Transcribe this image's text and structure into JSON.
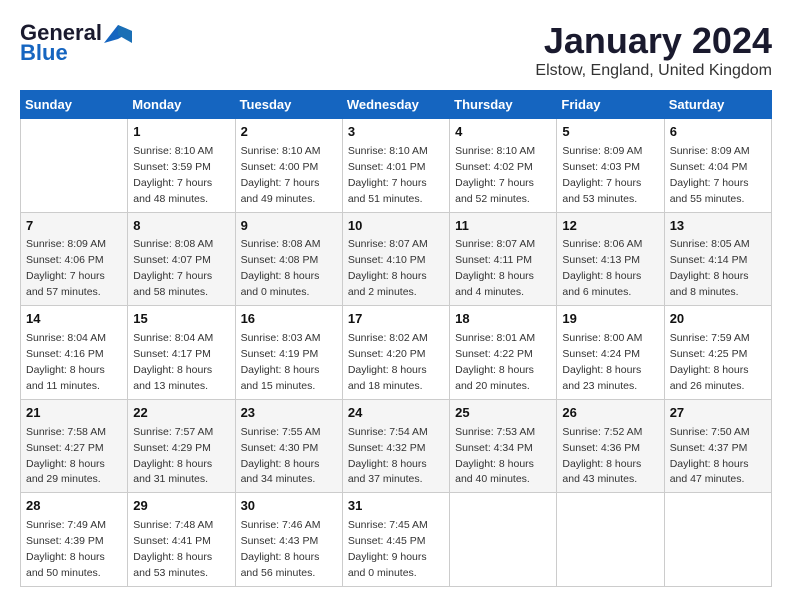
{
  "logo": {
    "line1": "General",
    "line2": "Blue"
  },
  "header": {
    "month": "January 2024",
    "location": "Elstow, England, United Kingdom"
  },
  "weekdays": [
    "Sunday",
    "Monday",
    "Tuesday",
    "Wednesday",
    "Thursday",
    "Friday",
    "Saturday"
  ],
  "weeks": [
    [
      {
        "day": "",
        "detail": ""
      },
      {
        "day": "1",
        "detail": "Sunrise: 8:10 AM\nSunset: 3:59 PM\nDaylight: 7 hours\nand 48 minutes."
      },
      {
        "day": "2",
        "detail": "Sunrise: 8:10 AM\nSunset: 4:00 PM\nDaylight: 7 hours\nand 49 minutes."
      },
      {
        "day": "3",
        "detail": "Sunrise: 8:10 AM\nSunset: 4:01 PM\nDaylight: 7 hours\nand 51 minutes."
      },
      {
        "day": "4",
        "detail": "Sunrise: 8:10 AM\nSunset: 4:02 PM\nDaylight: 7 hours\nand 52 minutes."
      },
      {
        "day": "5",
        "detail": "Sunrise: 8:09 AM\nSunset: 4:03 PM\nDaylight: 7 hours\nand 53 minutes."
      },
      {
        "day": "6",
        "detail": "Sunrise: 8:09 AM\nSunset: 4:04 PM\nDaylight: 7 hours\nand 55 minutes."
      }
    ],
    [
      {
        "day": "7",
        "detail": "Sunrise: 8:09 AM\nSunset: 4:06 PM\nDaylight: 7 hours\nand 57 minutes."
      },
      {
        "day": "8",
        "detail": "Sunrise: 8:08 AM\nSunset: 4:07 PM\nDaylight: 7 hours\nand 58 minutes."
      },
      {
        "day": "9",
        "detail": "Sunrise: 8:08 AM\nSunset: 4:08 PM\nDaylight: 8 hours\nand 0 minutes."
      },
      {
        "day": "10",
        "detail": "Sunrise: 8:07 AM\nSunset: 4:10 PM\nDaylight: 8 hours\nand 2 minutes."
      },
      {
        "day": "11",
        "detail": "Sunrise: 8:07 AM\nSunset: 4:11 PM\nDaylight: 8 hours\nand 4 minutes."
      },
      {
        "day": "12",
        "detail": "Sunrise: 8:06 AM\nSunset: 4:13 PM\nDaylight: 8 hours\nand 6 minutes."
      },
      {
        "day": "13",
        "detail": "Sunrise: 8:05 AM\nSunset: 4:14 PM\nDaylight: 8 hours\nand 8 minutes."
      }
    ],
    [
      {
        "day": "14",
        "detail": "Sunrise: 8:04 AM\nSunset: 4:16 PM\nDaylight: 8 hours\nand 11 minutes."
      },
      {
        "day": "15",
        "detail": "Sunrise: 8:04 AM\nSunset: 4:17 PM\nDaylight: 8 hours\nand 13 minutes."
      },
      {
        "day": "16",
        "detail": "Sunrise: 8:03 AM\nSunset: 4:19 PM\nDaylight: 8 hours\nand 15 minutes."
      },
      {
        "day": "17",
        "detail": "Sunrise: 8:02 AM\nSunset: 4:20 PM\nDaylight: 8 hours\nand 18 minutes."
      },
      {
        "day": "18",
        "detail": "Sunrise: 8:01 AM\nSunset: 4:22 PM\nDaylight: 8 hours\nand 20 minutes."
      },
      {
        "day": "19",
        "detail": "Sunrise: 8:00 AM\nSunset: 4:24 PM\nDaylight: 8 hours\nand 23 minutes."
      },
      {
        "day": "20",
        "detail": "Sunrise: 7:59 AM\nSunset: 4:25 PM\nDaylight: 8 hours\nand 26 minutes."
      }
    ],
    [
      {
        "day": "21",
        "detail": "Sunrise: 7:58 AM\nSunset: 4:27 PM\nDaylight: 8 hours\nand 29 minutes."
      },
      {
        "day": "22",
        "detail": "Sunrise: 7:57 AM\nSunset: 4:29 PM\nDaylight: 8 hours\nand 31 minutes."
      },
      {
        "day": "23",
        "detail": "Sunrise: 7:55 AM\nSunset: 4:30 PM\nDaylight: 8 hours\nand 34 minutes."
      },
      {
        "day": "24",
        "detail": "Sunrise: 7:54 AM\nSunset: 4:32 PM\nDaylight: 8 hours\nand 37 minutes."
      },
      {
        "day": "25",
        "detail": "Sunrise: 7:53 AM\nSunset: 4:34 PM\nDaylight: 8 hours\nand 40 minutes."
      },
      {
        "day": "26",
        "detail": "Sunrise: 7:52 AM\nSunset: 4:36 PM\nDaylight: 8 hours\nand 43 minutes."
      },
      {
        "day": "27",
        "detail": "Sunrise: 7:50 AM\nSunset: 4:37 PM\nDaylight: 8 hours\nand 47 minutes."
      }
    ],
    [
      {
        "day": "28",
        "detail": "Sunrise: 7:49 AM\nSunset: 4:39 PM\nDaylight: 8 hours\nand 50 minutes."
      },
      {
        "day": "29",
        "detail": "Sunrise: 7:48 AM\nSunset: 4:41 PM\nDaylight: 8 hours\nand 53 minutes."
      },
      {
        "day": "30",
        "detail": "Sunrise: 7:46 AM\nSunset: 4:43 PM\nDaylight: 8 hours\nand 56 minutes."
      },
      {
        "day": "31",
        "detail": "Sunrise: 7:45 AM\nSunset: 4:45 PM\nDaylight: 9 hours\nand 0 minutes."
      },
      {
        "day": "",
        "detail": ""
      },
      {
        "day": "",
        "detail": ""
      },
      {
        "day": "",
        "detail": ""
      }
    ]
  ]
}
